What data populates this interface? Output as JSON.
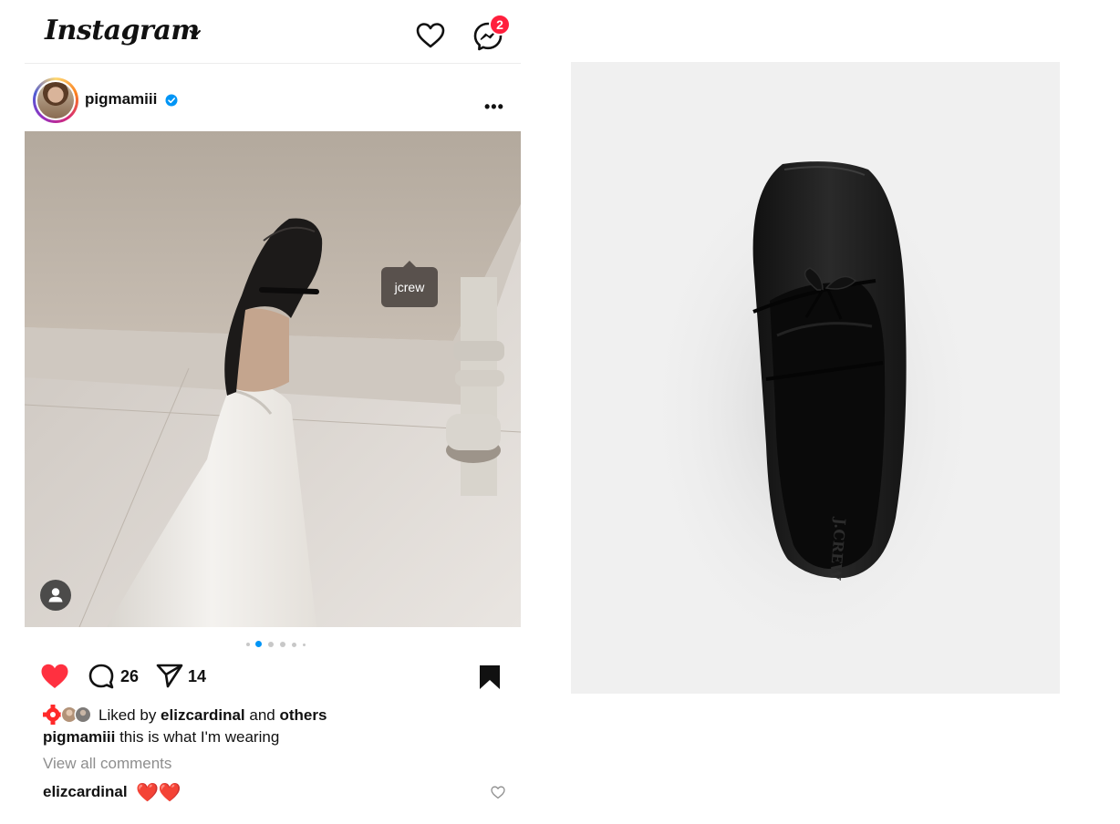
{
  "header": {
    "logo_text": "Instagram",
    "chevron_icon": "chevron-down-icon",
    "activity_icon": "heart-outline-icon",
    "messages_icon": "messenger-icon",
    "messages_badge": "2"
  },
  "post": {
    "username": "pigmamiii",
    "verified": true,
    "more_icon": "more-horizontal-icon",
    "more_glyph": "•••",
    "product_tag": "jcrew",
    "carousel": {
      "count": 6,
      "active_index": 1
    },
    "actions": {
      "liked": true,
      "comment_count": "26",
      "share_count": "14",
      "saved": true
    },
    "likes": {
      "prefix": "Liked by ",
      "user": "elizcardinal",
      "middle": " and ",
      "suffix": "others"
    },
    "caption": {
      "username": "pigmamiii",
      "text": " this is what I'm wearing"
    },
    "view_all_comments": "View all comments",
    "top_comment": {
      "username": "elizcardinal",
      "text": "❤️❤️"
    }
  },
  "colors": {
    "like_red": "#ff3040",
    "badge_red": "#ff1f3d",
    "verified_blue": "#0095f6",
    "muted_text": "#8e8e8e",
    "product_bg": "#f0f0f0"
  }
}
